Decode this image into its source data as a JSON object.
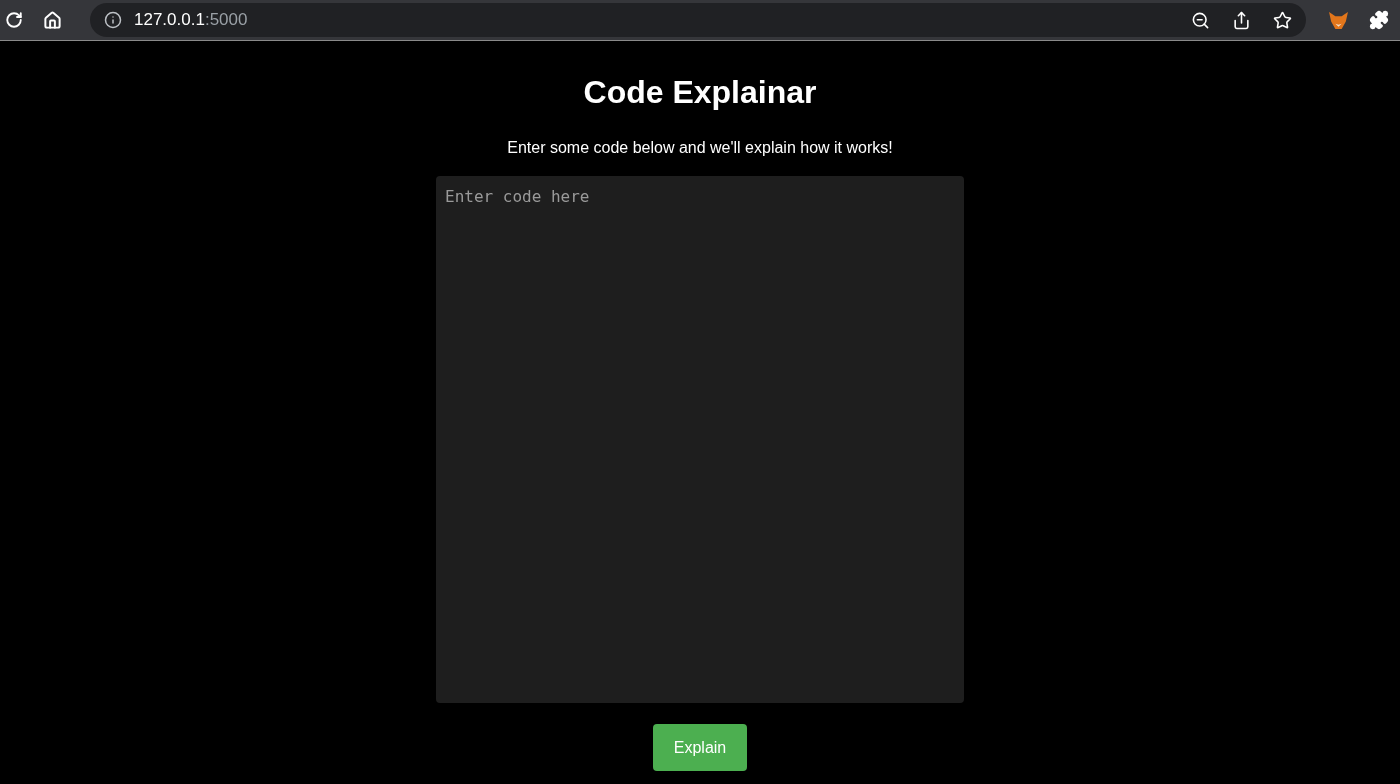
{
  "browser": {
    "url_host": "127.0.0.1",
    "url_rest": ":5000"
  },
  "page": {
    "title": "Code Explainar",
    "subtitle": "Enter some code below and we'll explain how it works!",
    "code_field": {
      "placeholder": "Enter code here"
    },
    "button": "Explain"
  }
}
